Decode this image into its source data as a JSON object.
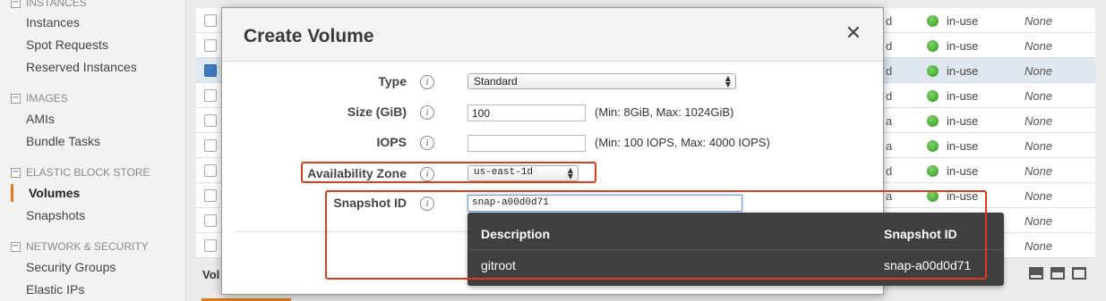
{
  "sidebar": {
    "sections": [
      {
        "label": "INSTANCES",
        "toggle": "−",
        "items": [
          "Instances",
          "Spot Requests",
          "Reserved Instances"
        ]
      },
      {
        "label": "IMAGES",
        "toggle": "−",
        "items": [
          "AMIs",
          "Bundle Tasks"
        ]
      },
      {
        "label": "ELASTIC BLOCK STORE",
        "toggle": "−",
        "items": [
          "Volumes",
          "Snapshots"
        ]
      },
      {
        "label": "NETWORK & SECURITY",
        "toggle": "−",
        "items": [
          "Security Groups",
          "Elastic IPs"
        ]
      }
    ],
    "active_item": "Volumes"
  },
  "table": {
    "rows": [
      {
        "frag": "d",
        "state": "in-use",
        "alarm": "None",
        "selected": false
      },
      {
        "frag": "d",
        "state": "in-use",
        "alarm": "None",
        "selected": false
      },
      {
        "frag": "d",
        "state": "in-use",
        "alarm": "None",
        "selected": true
      },
      {
        "frag": "d",
        "state": "in-use",
        "alarm": "None",
        "selected": false
      },
      {
        "frag": "a",
        "state": "in-use",
        "alarm": "None",
        "selected": false
      },
      {
        "frag": "a",
        "state": "in-use",
        "alarm": "None",
        "selected": false
      },
      {
        "frag": "d",
        "state": "in-use",
        "alarm": "None",
        "selected": false
      },
      {
        "frag": "a",
        "state": "in-use",
        "alarm": "None",
        "selected": false
      },
      {
        "frag": "",
        "state": "",
        "alarm": "None",
        "selected": false
      },
      {
        "frag": "",
        "state": "",
        "alarm": "None",
        "selected": false
      }
    ],
    "footer_label": "Vol"
  },
  "modal": {
    "title": "Create Volume",
    "close_glyph": "✕",
    "info_glyph": "i",
    "type": {
      "label": "Type",
      "value": "Standard"
    },
    "size": {
      "label": "Size (GiB)",
      "value": "100",
      "hint": "(Min: 8GiB, Max: 1024GiB)"
    },
    "iops": {
      "label": "IOPS",
      "value": "",
      "hint": "(Min: 100 IOPS, Max: 4000 IOPS)"
    },
    "zone": {
      "label": "Availability Zone",
      "value": "us-east-1d"
    },
    "snapshot": {
      "label": "Snapshot ID",
      "value": "snap-a00d0d71"
    }
  },
  "popup": {
    "header_description": "Description",
    "header_snapshot": "Snapshot ID",
    "rows": [
      {
        "description": "gitroot",
        "snapshot_id": "snap-a00d0d71"
      }
    ]
  },
  "colors": {
    "highlight": "#e03a1e",
    "accent": "#e07c1b",
    "status_green": "#2f9a1e",
    "popup_bg": "#3f3f3f"
  }
}
